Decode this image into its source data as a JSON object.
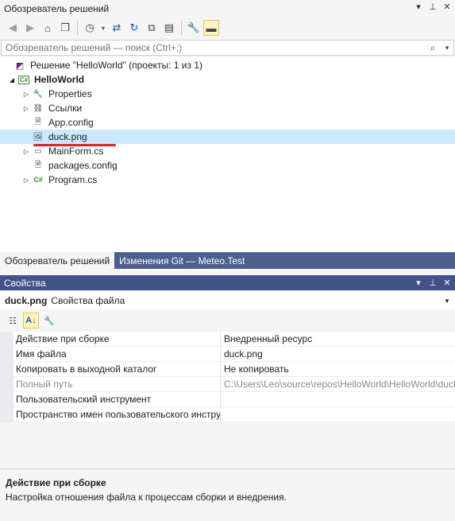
{
  "solution_explorer": {
    "title": "Обозреватель решений",
    "search_placeholder": "Обозреватель решений — поиск (Ctrl+;)",
    "tree": {
      "solution": "Решение \"HelloWorld\" (проекты: 1 из 1)",
      "project": "HelloWorld",
      "items": [
        {
          "label": "Properties",
          "icon": "wrench-icon"
        },
        {
          "label": "Ссылки",
          "icon": "references-icon"
        },
        {
          "label": "App.config",
          "icon": "config-file-icon"
        },
        {
          "label": "duck.png",
          "icon": "image-file-icon",
          "selected": true
        },
        {
          "label": "MainForm.cs",
          "icon": "form-icon"
        },
        {
          "label": "packages.config",
          "icon": "config-file-icon"
        },
        {
          "label": "Program.cs",
          "icon": "csharp-file-icon"
        }
      ]
    },
    "tabs": [
      "Обозреватель решений",
      "Изменения Git — Meteo.Test"
    ]
  },
  "properties": {
    "title": "Свойства",
    "object_name": "duck.png",
    "object_type": "Свойства файла",
    "rows": [
      {
        "name": "Действие при сборке",
        "value": "Внедренный ресурс"
      },
      {
        "name": "Имя файла",
        "value": "duck.png"
      },
      {
        "name": "Копировать в выходной каталог",
        "value": "Не копировать"
      },
      {
        "name": "Полный путь",
        "value": "C:\\Users\\Leo\\source\\repos\\HelloWorld\\HelloWorld\\duck.png"
      },
      {
        "name": "Пользовательский инструмент",
        "value": ""
      },
      {
        "name": "Пространство имен пользовательского инструмента",
        "value": ""
      }
    ],
    "description": {
      "title": "Действие при сборке",
      "text": "Настройка отношения файла к процессам сборки и внедрения."
    }
  },
  "colors": {
    "accent_blue": "#425188",
    "tab_bar": "#4d5f8e",
    "selection": "#cce8ff",
    "highlight_underline": "#d0282d"
  }
}
